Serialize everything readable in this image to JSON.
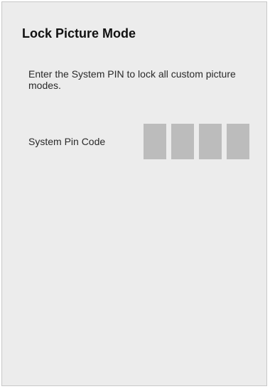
{
  "dialog": {
    "title": "Lock Picture Mode",
    "description": "Enter the System PIN to lock all custom picture modes.",
    "pin_label": "System Pin Code",
    "pin_digits": [
      "",
      "",
      "",
      ""
    ],
    "colors": {
      "panel_background": "#ececec",
      "panel_border": "#c8c8c8",
      "pin_box": "#bcbcbc"
    }
  }
}
